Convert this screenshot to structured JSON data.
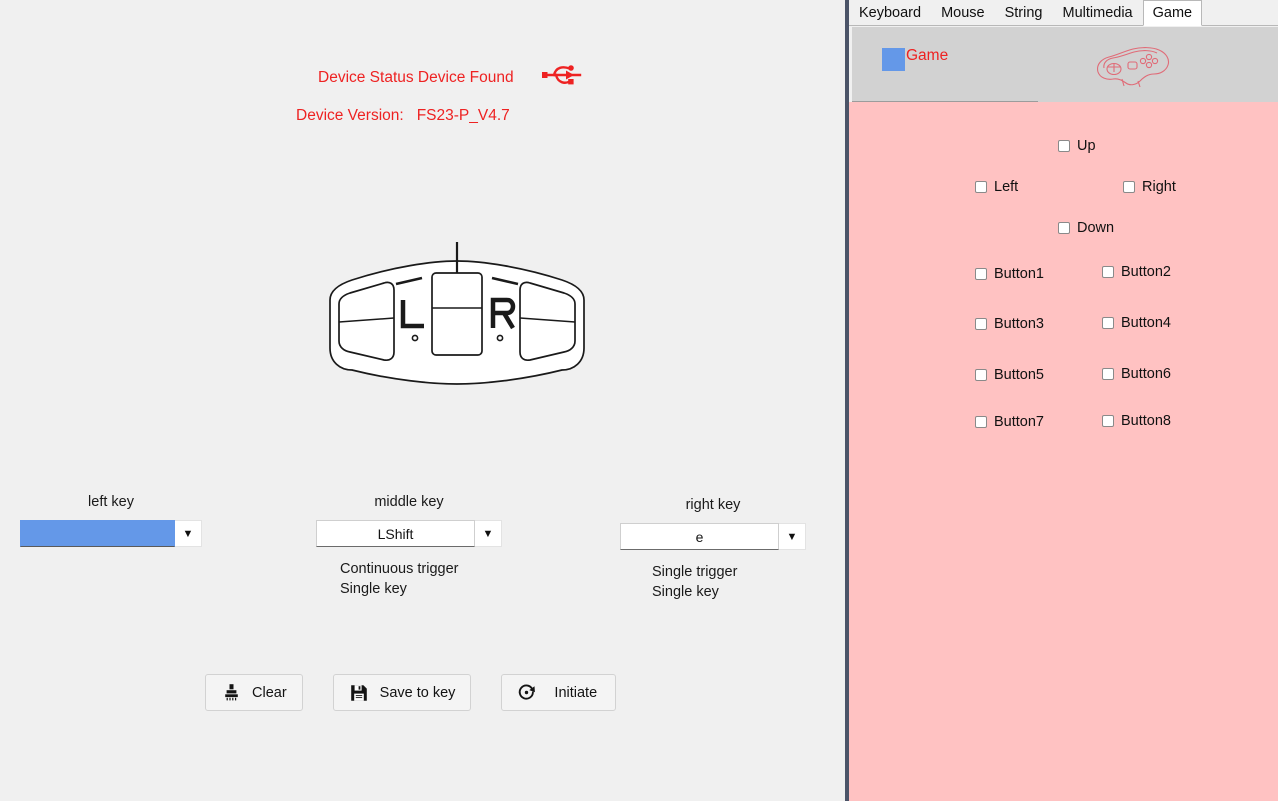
{
  "device": {
    "status_text": "Device Status Device Found",
    "version_label": "Device Version:",
    "version_value": "FS23-P_V4.7",
    "status_color": "#ee2222",
    "usb_icon": "usb-icon",
    "graphic_icon": "foot-pedal-diagram",
    "pedal_left_label": "L",
    "pedal_right_label": "R"
  },
  "keys": {
    "left": {
      "title": "left key",
      "value": "",
      "trigger_mode": "",
      "key_mode": "",
      "selected": true
    },
    "middle": {
      "title": "middle key",
      "value": "LShift",
      "trigger_mode": "Continuous trigger",
      "key_mode": "Single key",
      "selected": false
    },
    "right": {
      "title": "right key",
      "value": "e",
      "trigger_mode": "Single trigger",
      "key_mode": "Single key",
      "selected": false
    },
    "dropdown_arrow": "chevron-down-icon"
  },
  "actions": {
    "clear_label": "Clear",
    "clear_icon": "brush-icon",
    "save_label": "Save to key",
    "save_icon": "floppy-disk-icon",
    "initiate_label": "Initiate",
    "initiate_icon": "refresh-circle-icon"
  },
  "tabs": [
    {
      "label": "Keyboard",
      "active": false
    },
    {
      "label": "Mouse",
      "active": false
    },
    {
      "label": "String",
      "active": false
    },
    {
      "label": "Multimedia",
      "active": false
    },
    {
      "label": "Game",
      "active": true
    }
  ],
  "game_panel": {
    "header_title": "Game",
    "header_swatch_color": "#6498e8",
    "header_icon": "gamepad-icon",
    "body_color": "#ffc2c2",
    "directions": [
      {
        "label": "Up",
        "checked": false
      },
      {
        "label": "Left",
        "checked": false
      },
      {
        "label": "Right",
        "checked": false
      },
      {
        "label": "Down",
        "checked": false
      }
    ],
    "buttons": [
      {
        "label": "Button1",
        "checked": false
      },
      {
        "label": "Button2",
        "checked": false
      },
      {
        "label": "Button3",
        "checked": false
      },
      {
        "label": "Button4",
        "checked": false
      },
      {
        "label": "Button5",
        "checked": false
      },
      {
        "label": "Button6",
        "checked": false
      },
      {
        "label": "Button7",
        "checked": false
      },
      {
        "label": "Button8",
        "checked": false
      }
    ]
  }
}
